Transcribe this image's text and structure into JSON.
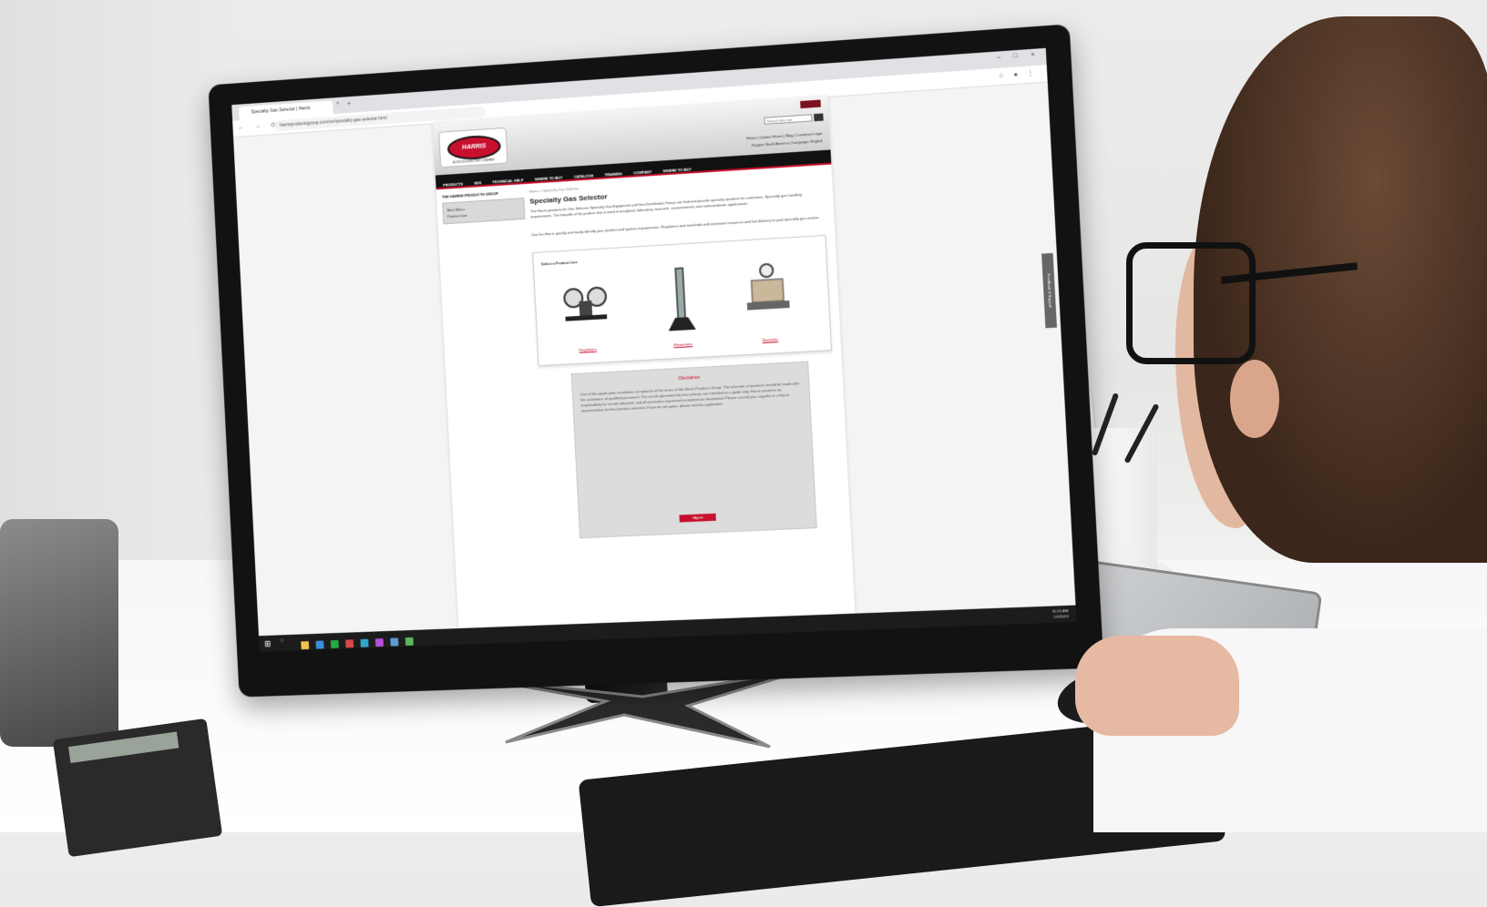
{
  "browser": {
    "tab_title": "Specialty Gas Selector | Harris",
    "new_tab_glyph": "+",
    "close_glyph": "×",
    "window_controls": "– □ ×",
    "url": "harrisproductsgroup.com/en/specialty-gas-selector.html",
    "nav_glyphs": "← → ⟳",
    "ext_glyphs": "☆ ● ⋮"
  },
  "site": {
    "logo_text": "HARRIS",
    "logo_sub": "A LINCOLN ELECTRIC COMPANY",
    "search_placeholder": "Search this site",
    "util_links": [
      "Home | Contact Harris | Blog | Customer Login",
      "Region: North America | Language: English"
    ],
    "nav": [
      "PRODUCTS",
      "SDS",
      "TECHNICAL HELP",
      "WHERE TO BUY",
      "CATALOGS",
      "TRAINING",
      "COMPANY",
      "WHERE TO BUY"
    ],
    "sidebar_title": "THE HARRIS PRODUCTS GROUP",
    "sidebar_items": [
      "Main Menu",
      "Product Line"
    ],
    "breadcrumb": "Home > Specialty Gas Selector",
    "page_title": "Specialty Gas Selector",
    "intro_1": "The Harris products for Gas Selector Specialty Gas Equipment and Gas Distribution Group can find and provide specialty products for customers. Specialty gas handling requirements. The breadth of the product line is used in analytical, laboratory, research, environmental, and semiconductor applications.",
    "intro_2": "Use the Harris quickly and easily identify your product and system requirements. Regulators and manifolds with extensive resources and fast delivery to your specialty gas service.",
    "select_label": "Select a Product Line",
    "products": [
      "Regulators",
      "Flowmeters",
      "Manifolds"
    ],
    "disclaimer_title": "Disclaimer",
    "disclaimer_text": "Use of this application constitutes acceptance of the terms of the Harris Products Group. The selection of products should be made with the assistance of qualified personnel. The results generated by this selector are intended as a guide only. Harris assumes no responsibility for results obtained, and all warranties expressed or implied are disclaimed. Please consult your supplier or a Harris representative for final product selection. If you do not agree, please exit this application.",
    "disclaimer_button": "I Agree",
    "feedback_tab": "Feedback & Support"
  },
  "taskbar": {
    "start_glyph": "⊞",
    "search_glyph": "○",
    "time": "10:15 AM",
    "date": "1/1/2019",
    "app_colors": [
      "#f2c14e",
      "#3a8fd9",
      "#27a844",
      "#d94848",
      "#2fa6c8",
      "#b84fd9",
      "#5a9bd5",
      "#5cb85c"
    ]
  },
  "colors": {
    "brand_red": "#c8102e",
    "nav_black": "#111111",
    "monitor_bezel": "#121212"
  }
}
